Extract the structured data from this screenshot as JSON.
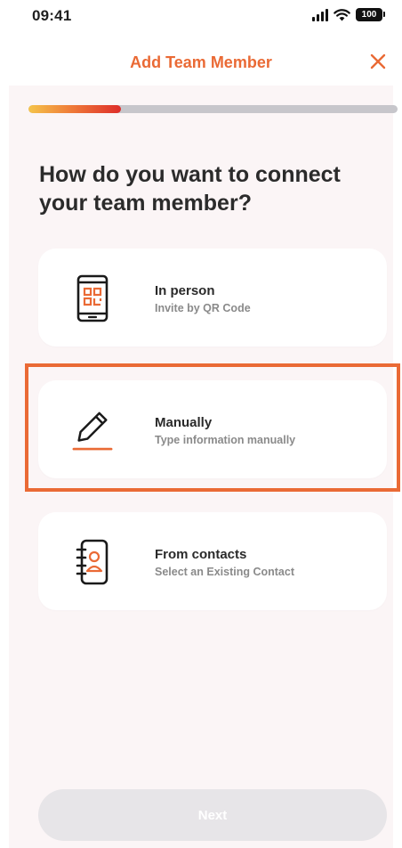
{
  "status_bar": {
    "time": "09:41",
    "battery": "100"
  },
  "header": {
    "title": "Add Team Member",
    "close_icon": "close-icon"
  },
  "progress": {
    "fraction": 0.25
  },
  "question": "How do you want to connect your team member?",
  "options": [
    {
      "icon": "phone-qr-code-icon",
      "title": "In person",
      "subtitle": "Invite by QR Code"
    },
    {
      "icon": "pencil-icon",
      "title": "Manually",
      "subtitle": "Type information manually"
    },
    {
      "icon": "contact-book-icon",
      "title": "From contacts",
      "subtitle": "Select an Existing Contact"
    }
  ],
  "next_button": {
    "label": "Next"
  },
  "colors": {
    "accent": "#ea6a35",
    "highlight": "#ea6a35",
    "background": "#fbf5f6",
    "progress_start": "#f5c44a",
    "progress_end": "#de2d2a",
    "button_disabled": "#e7e5e8"
  }
}
